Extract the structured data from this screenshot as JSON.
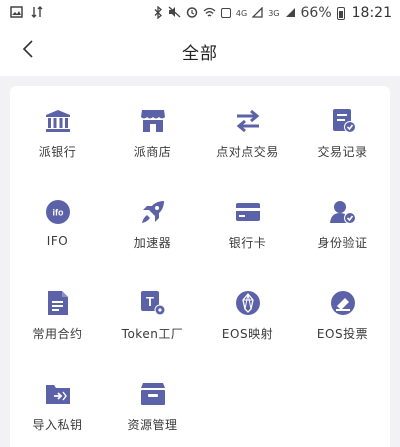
{
  "status_bar": {
    "network_4g": "4G",
    "network_3g": "3G",
    "battery_percent": "66%",
    "time": "18:21"
  },
  "header": {
    "title": "全部"
  },
  "colors": {
    "icon": "#5b62a8",
    "background": "#f2f2f4",
    "panel": "#ffffff"
  },
  "items": [
    {
      "label": "派银行",
      "icon": "bank-icon"
    },
    {
      "label": "派商店",
      "icon": "store-icon"
    },
    {
      "label": "点对点交易",
      "icon": "swap-arrows-icon"
    },
    {
      "label": "交易记录",
      "icon": "record-icon"
    },
    {
      "label": "IFO",
      "icon": "ifo-icon"
    },
    {
      "label": "加速器",
      "icon": "rocket-icon"
    },
    {
      "label": "银行卡",
      "icon": "card-icon"
    },
    {
      "label": "身份验证",
      "icon": "user-verify-icon"
    },
    {
      "label": "常用合约",
      "icon": "document-icon"
    },
    {
      "label": "Token工厂",
      "icon": "token-factory-icon"
    },
    {
      "label": "EOS映射",
      "icon": "eos-icon"
    },
    {
      "label": "EOS投票",
      "icon": "vote-icon"
    },
    {
      "label": "导入私钥",
      "icon": "import-key-icon"
    },
    {
      "label": "资源管理",
      "icon": "resource-icon"
    }
  ]
}
